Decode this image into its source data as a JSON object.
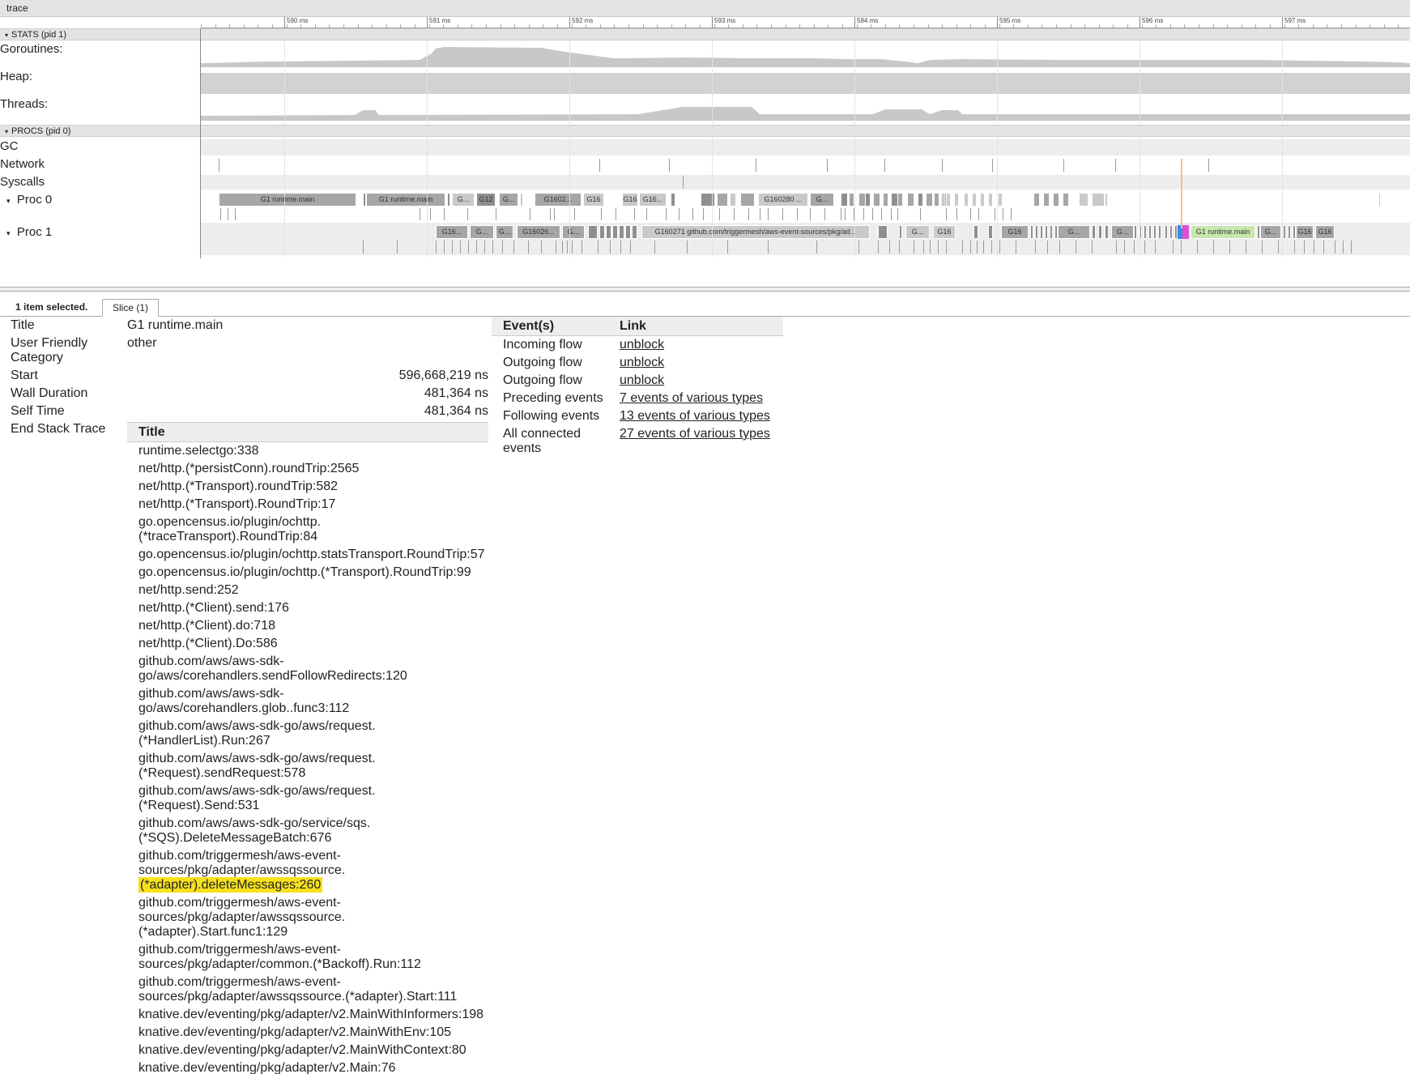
{
  "window": {
    "title": "trace"
  },
  "timeline": {
    "ticks": [
      "590 ms",
      "591 ms",
      "592 ms",
      "593 ms",
      "594 ms",
      "595 ms",
      "596 ms",
      "597 ms"
    ]
  },
  "stats": {
    "header": "STATS (pid 1)",
    "rows": [
      "Goroutines:",
      "Heap:",
      "Threads:"
    ]
  },
  "procs": {
    "header": "PROCS (pid 0)",
    "rows": [
      "GC",
      "Network",
      "Syscalls"
    ],
    "proc0": {
      "label": "Proc 0"
    },
    "proc1": {
      "label": "Proc 1"
    },
    "slices0": [
      "G1 runtime.main",
      "G1 runtime.main",
      "G...",
      "G12",
      "G...",
      "G1602...",
      "G16",
      "G16",
      "G16...",
      "G160280 ...",
      "G..."
    ],
    "slices1": [
      "G16...",
      "G...",
      "G...",
      "G16026...",
      "G...",
      "G160271 github.com/triggermesh/aws-event-sources/pkg/ad...",
      "G...",
      "G16",
      "G16",
      "G...",
      "G...",
      "G1 runtime.main",
      "G...",
      "G16",
      "G16"
    ]
  },
  "analysis": {
    "selected_count": "1 item selected.",
    "tab_label": "Slice (1)",
    "fields": {
      "title_label": "Title",
      "title_value": "G1 runtime.main",
      "category_label": "User Friendly\nCategory",
      "category_value": "other",
      "start_label": "Start",
      "start_value": "596,668,219 ns",
      "wall_label": "Wall Duration",
      "wall_value": "481,364 ns",
      "self_label": "Self Time",
      "self_value": "481,364 ns",
      "stack_label": "End Stack Trace"
    },
    "stack": {
      "header": "Title",
      "frames": [
        "runtime.selectgo:338",
        "net/http.(*persistConn).roundTrip:2565",
        "net/http.(*Transport).roundTrip:582",
        "net/http.(*Transport).RoundTrip:17",
        "go.opencensus.io/plugin/ochttp.\n(*traceTransport).RoundTrip:84",
        "go.opencensus.io/plugin/ochttp.statsTransport.RoundTrip:57",
        "go.opencensus.io/plugin/ochttp.(*Transport).RoundTrip:99",
        "net/http.send:252",
        "net/http.(*Client).send:176",
        "net/http.(*Client).do:718",
        "net/http.(*Client).Do:586",
        "github.com/aws/aws-sdk-\ngo/aws/corehandlers.sendFollowRedirects:120",
        "github.com/aws/aws-sdk-\ngo/aws/corehandlers.glob..func3:112",
        "github.com/aws/aws-sdk-go/aws/request.\n(*HandlerList).Run:267",
        "github.com/aws/aws-sdk-go/aws/request.\n(*Request).sendRequest:578",
        "github.com/aws/aws-sdk-go/aws/request.\n(*Request).Send:531",
        "github.com/aws/aws-sdk-go/service/sqs.\n(*SQS).DeleteMessageBatch:676",
        "github.com/triggermesh/aws-event-\nsources/pkg/adapter/awssqssource."
      ],
      "highlight": "(*adapter).deleteMessages:260",
      "frames_after": [
        "github.com/triggermesh/aws-event-\nsources/pkg/adapter/awssqssource.\n(*adapter).Start.func1:129",
        "github.com/triggermesh/aws-event-\nsources/pkg/adapter/common.(*Backoff).Run:112",
        "github.com/triggermesh/aws-event-\nsources/pkg/adapter/awssqssource.(*adapter).Start:111",
        "knative.dev/eventing/pkg/adapter/v2.MainWithInformers:198",
        "knative.dev/eventing/pkg/adapter/v2.MainWithEnv:105",
        "knative.dev/eventing/pkg/adapter/v2.MainWithContext:80",
        "knative.dev/eventing/pkg/adapter/v2.Main:76"
      ]
    },
    "events": {
      "col_event": "Event(s)",
      "col_link": "Link",
      "rows": [
        {
          "event": "Incoming flow",
          "link": "unblock"
        },
        {
          "event": "Outgoing flow",
          "link": "unblock"
        },
        {
          "event": "Outgoing flow",
          "link": "unblock"
        },
        {
          "event": "Preceding events",
          "link": "7 events of various types"
        },
        {
          "event": "Following events",
          "link": "13 events of various types"
        },
        {
          "event": "All connected\nevents",
          "link": "27 events of various types"
        }
      ]
    }
  }
}
